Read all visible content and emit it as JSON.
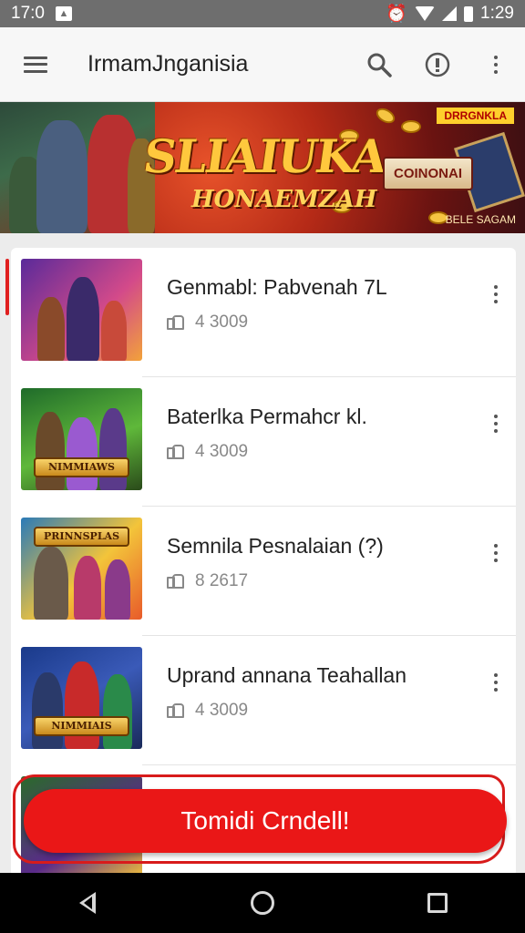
{
  "status_bar": {
    "time_left": "17:0",
    "notif_icon": "notification-icon",
    "time_right": "1:29"
  },
  "app_bar": {
    "title": "IrmamJnganisia",
    "menu_icon": "hamburger-icon",
    "search_icon": "search-icon",
    "info_icon": "info-icon",
    "more_icon": "more-vert-icon"
  },
  "banner": {
    "title": "SLIAIUKA",
    "subtitle": "HONAEMZAH",
    "badge": "DRRGNKLA",
    "button": "COINONAI",
    "footer": "BELE SAGAM"
  },
  "list": {
    "items": [
      {
        "title": "Genmabl: Pabvenah 7L",
        "rating": "4 3009",
        "thumb_colors": [
          "#5a2a9a",
          "#d34a8a",
          "#f2a23a"
        ]
      },
      {
        "title": "Baterlka Permahcr kl.",
        "rating": "4 3009",
        "thumb_colors": [
          "#1f6b2a",
          "#5fb83a",
          "#9a5ad0"
        ]
      },
      {
        "title": "Semnila Pesnalaian (?)",
        "rating": "8 2617",
        "thumb_colors": [
          "#2a7ab8",
          "#f3c43a",
          "#e85a2a"
        ]
      },
      {
        "title": "Uprand annana Teahallan",
        "rating": "4 3009",
        "thumb_colors": [
          "#1a3a8a",
          "#c82a2a",
          "#2a8a4a"
        ]
      }
    ],
    "thumb_logos": [
      "",
      "NIMMIAWS",
      "PRINNSPLAS",
      "NIMMIAIS"
    ]
  },
  "cta": {
    "label": "Tomidi Crndell!"
  },
  "nav": {
    "back_icon": "back-icon",
    "home_icon": "home-icon",
    "recents_icon": "recents-icon"
  }
}
